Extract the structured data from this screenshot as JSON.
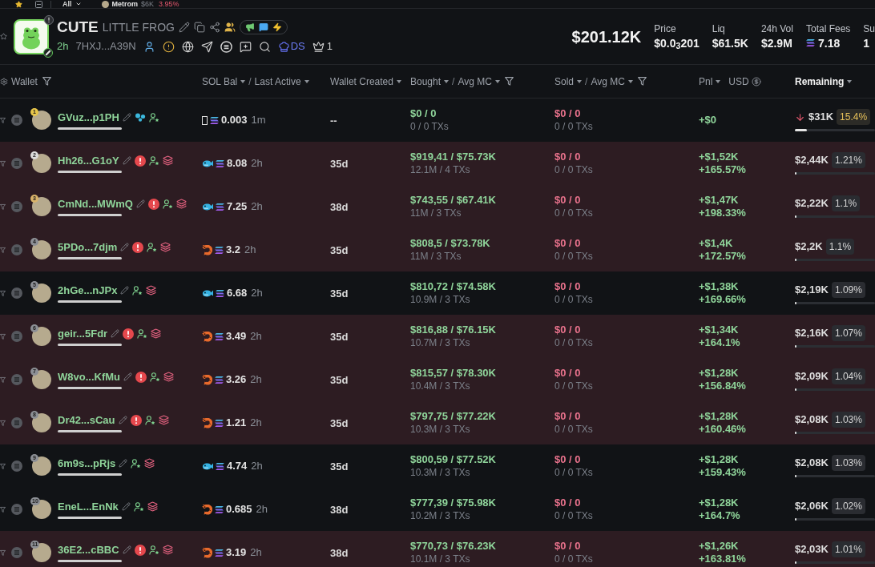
{
  "top_bar": {
    "filter": "All",
    "ticker": {
      "name": "Metrom",
      "price": "$6K",
      "change": "3.95%"
    }
  },
  "token": {
    "symbol": "CUTE",
    "name": "LITTLE FROG",
    "age": "2h",
    "address": "7HXJ...A39N",
    "ds_label": "DS",
    "crown_count": "1",
    "market_cap": "$201.12K",
    "stats": [
      {
        "label": "Price",
        "value": "$0.0$_{3}$201",
        "kind": "plain"
      },
      {
        "label": "Liq",
        "value": "$61.5K",
        "kind": "plain"
      },
      {
        "label": "24h Vol",
        "value": "$2.9M",
        "kind": "plain"
      },
      {
        "label": "Total Fees",
        "value": "7.18",
        "kind": "sol"
      },
      {
        "label": "Su",
        "value": "1",
        "kind": "plain"
      }
    ]
  },
  "table": {
    "columns": [
      {
        "kind": "wallet",
        "parts": [
          {
            "kind": "label",
            "label": "Wallet",
            "sort": false
          }
        ],
        "filter": true,
        "active": false
      },
      {
        "kind": "sol",
        "parts": [
          {
            "kind": "label",
            "label": "SOL Bal",
            "sort": true
          },
          {
            "kind": "separator",
            "label": "/",
            "sort": false
          },
          {
            "kind": "label",
            "label": "Last Active",
            "sort": true
          }
        ],
        "filter": false,
        "active": false
      },
      {
        "kind": "created",
        "parts": [
          {
            "kind": "label",
            "label": "Wallet Created",
            "sort": true
          }
        ],
        "filter": false,
        "active": false
      },
      {
        "kind": "bought",
        "parts": [
          {
            "kind": "label",
            "label": "Bought",
            "sort": true
          },
          {
            "kind": "separator",
            "label": "/",
            "sort": false
          },
          {
            "kind": "label",
            "label": "Avg MC",
            "sort": true
          }
        ],
        "filter": true,
        "active": false
      },
      {
        "kind": "sold",
        "parts": [
          {
            "kind": "label",
            "label": "Sold",
            "sort": true
          },
          {
            "kind": "separator",
            "label": "/",
            "sort": false
          },
          {
            "kind": "label",
            "label": "Avg MC",
            "sort": true
          }
        ],
        "filter": true,
        "active": false
      },
      {
        "kind": "pnl",
        "parts": [
          {
            "kind": "label",
            "label": "Pnl",
            "sort": true
          }
        ],
        "unit": "USD",
        "filter": false,
        "active": false
      },
      {
        "kind": "remaining",
        "parts": [
          {
            "kind": "label",
            "label": "Remaining",
            "sort": true
          }
        ],
        "filter": false,
        "active": true
      }
    ],
    "rows": [
      {
        "rank": {
          "text": "1",
          "color": "#e8c64a"
        },
        "wallet": "GVuz...p1PH",
        "highlighted": false,
        "tags": [
          {
            "kind": "bubbles"
          },
          {
            "kind": "user_star"
          }
        ],
        "holder": {
          "kind": "box"
        },
        "sol": "0.003",
        "last_active": "1m",
        "created": "--",
        "bought": {
          "line": "$0 / 0",
          "detail": "0 / 0 TXs"
        },
        "sold": {
          "line": "$0 / 0",
          "detail": "0 / 0 TXs"
        },
        "pnl": {
          "usd": "+$0"
        },
        "remaining": {
          "usd": "$31K",
          "percent": "15.4%",
          "falling": true,
          "warning": true,
          "level": 0.154
        }
      },
      {
        "rank": {
          "text": "2",
          "color": "#dcdcdc"
        },
        "wallet": "Hh26...G1oY",
        "highlighted": true,
        "tags": [
          {
            "kind": "alert"
          },
          {
            "kind": "user_star"
          },
          {
            "kind": "layers"
          }
        ],
        "holder": {
          "kind": "fish"
        },
        "sol": "8.08",
        "last_active": "2h",
        "created": "35d",
        "bought": {
          "line": "$919,41 / $75.73K",
          "detail": "12.1M / 4 TXs"
        },
        "sold": {
          "line": "$0 / 0",
          "detail": "0 / 0 TXs"
        },
        "pnl": {
          "usd": "+$1,52K",
          "percent": "+165.57%"
        },
        "remaining": {
          "usd": "$2,44K",
          "percent": "1.21%",
          "falling": false,
          "warning": false,
          "level": 0.0121
        }
      },
      {
        "rank": {
          "text": "3",
          "color": "#d9b36a"
        },
        "wallet": "CmNd...MWmQ",
        "highlighted": true,
        "tags": [
          {
            "kind": "alert"
          },
          {
            "kind": "user_star"
          },
          {
            "kind": "layers"
          }
        ],
        "holder": {
          "kind": "fish"
        },
        "sol": "7.25",
        "last_active": "2h",
        "created": "38d",
        "bought": {
          "line": "$743,55 / $67.41K",
          "detail": "11M / 3 TXs"
        },
        "sold": {
          "line": "$0 / 0",
          "detail": "0 / 0 TXs"
        },
        "pnl": {
          "usd": "+$1,47K",
          "percent": "+198.33%"
        },
        "remaining": {
          "usd": "$2,22K",
          "percent": "1.1%",
          "falling": false,
          "warning": false,
          "level": 0.011
        }
      },
      {
        "rank": {
          "text": "4",
          "color": "#8c8f95"
        },
        "wallet": "5PDo...7djm",
        "highlighted": true,
        "tags": [
          {
            "kind": "alert"
          },
          {
            "kind": "user_star"
          },
          {
            "kind": "layers"
          }
        ],
        "holder": {
          "kind": "shrimp"
        },
        "sol": "3.2",
        "last_active": "2h",
        "created": "35d",
        "bought": {
          "line": "$808,5 / $73.78K",
          "detail": "11M / 3 TXs"
        },
        "sold": {
          "line": "$0 / 0",
          "detail": "0 / 0 TXs"
        },
        "pnl": {
          "usd": "+$1,4K",
          "percent": "+172.57%"
        },
        "remaining": {
          "usd": "$2,2K",
          "percent": "1.1%",
          "falling": false,
          "warning": false,
          "level": 0.011
        }
      },
      {
        "rank": {
          "text": "5",
          "color": "#8c8f95"
        },
        "wallet": "2hGe...nJPx",
        "highlighted": false,
        "tags": [
          {
            "kind": "user_star"
          },
          {
            "kind": "layers"
          }
        ],
        "holder": {
          "kind": "fish"
        },
        "sol": "6.68",
        "last_active": "2h",
        "created": "35d",
        "bought": {
          "line": "$810,72 / $74.58K",
          "detail": "10.9M / 3 TXs"
        },
        "sold": {
          "line": "$0 / 0",
          "detail": "0 / 0 TXs"
        },
        "pnl": {
          "usd": "+$1,38K",
          "percent": "+169.66%"
        },
        "remaining": {
          "usd": "$2,19K",
          "percent": "1.09%",
          "falling": false,
          "warning": false,
          "level": 0.0109
        }
      },
      {
        "rank": {
          "text": "6",
          "color": "#8c8f95"
        },
        "wallet": "geir...5Fdr",
        "highlighted": true,
        "tags": [
          {
            "kind": "alert"
          },
          {
            "kind": "user_star"
          },
          {
            "kind": "layers"
          }
        ],
        "holder": {
          "kind": "shrimp"
        },
        "sol": "3.49",
        "last_active": "2h",
        "created": "35d",
        "bought": {
          "line": "$816,88 / $76.15K",
          "detail": "10.7M / 3 TXs"
        },
        "sold": {
          "line": "$0 / 0",
          "detail": "0 / 0 TXs"
        },
        "pnl": {
          "usd": "+$1,34K",
          "percent": "+164.1%"
        },
        "remaining": {
          "usd": "$2,16K",
          "percent": "1.07%",
          "falling": false,
          "warning": false,
          "level": 0.0107
        }
      },
      {
        "rank": {
          "text": "7",
          "color": "#8c8f95"
        },
        "wallet": "W8vo...KfMu",
        "highlighted": true,
        "tags": [
          {
            "kind": "alert"
          },
          {
            "kind": "user_star"
          },
          {
            "kind": "layers"
          }
        ],
        "holder": {
          "kind": "shrimp"
        },
        "sol": "3.26",
        "last_active": "2h",
        "created": "35d",
        "bought": {
          "line": "$815,57 / $78.30K",
          "detail": "10.4M / 3 TXs"
        },
        "sold": {
          "line": "$0 / 0",
          "detail": "0 / 0 TXs"
        },
        "pnl": {
          "usd": "+$1,28K",
          "percent": "+156.84%"
        },
        "remaining": {
          "usd": "$2,09K",
          "percent": "1.04%",
          "falling": false,
          "warning": false,
          "level": 0.0104
        }
      },
      {
        "rank": {
          "text": "8",
          "color": "#8c8f95"
        },
        "wallet": "Dr42...sCau",
        "highlighted": true,
        "tags": [
          {
            "kind": "alert"
          },
          {
            "kind": "user_star"
          },
          {
            "kind": "layers"
          }
        ],
        "holder": {
          "kind": "shrimp"
        },
        "sol": "1.21",
        "last_active": "2h",
        "created": "35d",
        "bought": {
          "line": "$797,75 / $77.22K",
          "detail": "10.3M / 3 TXs"
        },
        "sold": {
          "line": "$0 / 0",
          "detail": "0 / 0 TXs"
        },
        "pnl": {
          "usd": "+$1,28K",
          "percent": "+160.46%"
        },
        "remaining": {
          "usd": "$2,08K",
          "percent": "1.03%",
          "falling": false,
          "warning": false,
          "level": 0.0103
        }
      },
      {
        "rank": {
          "text": "9",
          "color": "#8c8f95"
        },
        "wallet": "6m9s...pRjs",
        "highlighted": false,
        "tags": [
          {
            "kind": "user_star"
          },
          {
            "kind": "layers"
          }
        ],
        "holder": {
          "kind": "fish"
        },
        "sol": "4.74",
        "last_active": "2h",
        "created": "35d",
        "bought": {
          "line": "$800,59 / $77.52K",
          "detail": "10.3M / 3 TXs"
        },
        "sold": {
          "line": "$0 / 0",
          "detail": "0 / 0 TXs"
        },
        "pnl": {
          "usd": "+$1,28K",
          "percent": "+159.43%"
        },
        "remaining": {
          "usd": "$2,08K",
          "percent": "1.03%",
          "falling": false,
          "warning": false,
          "level": 0.0103
        }
      },
      {
        "rank": {
          "text": "10",
          "color": "#8c8f95"
        },
        "wallet": "EneL...EnNk",
        "highlighted": false,
        "tags": [
          {
            "kind": "user_star"
          },
          {
            "kind": "layers"
          }
        ],
        "holder": {
          "kind": "shrimp"
        },
        "sol": "0.685",
        "last_active": "2h",
        "created": "38d",
        "bought": {
          "line": "$777,39 / $75.98K",
          "detail": "10.2M / 3 TXs"
        },
        "sold": {
          "line": "$0 / 0",
          "detail": "0 / 0 TXs"
        },
        "pnl": {
          "usd": "+$1,28K",
          "percent": "+164.7%"
        },
        "remaining": {
          "usd": "$2,06K",
          "percent": "1.02%",
          "falling": false,
          "warning": false,
          "level": 0.0102
        }
      },
      {
        "rank": {
          "text": "11",
          "color": "#8c8f95"
        },
        "wallet": "36E2...cBBC",
        "highlighted": true,
        "tags": [
          {
            "kind": "alert"
          },
          {
            "kind": "user_star"
          },
          {
            "kind": "layers"
          }
        ],
        "holder": {
          "kind": "shrimp"
        },
        "sol": "3.19",
        "last_active": "2h",
        "created": "38d",
        "bought": {
          "line": "$770,73 / $76.23K",
          "detail": "10.1M / 3 TXs"
        },
        "sold": {
          "line": "$0 / 0",
          "detail": "0 / 0 TXs"
        },
        "pnl": {
          "usd": "+$1,26K",
          "percent": "+163.81%"
        },
        "remaining": {
          "usd": "$2,03K",
          "percent": "1.01%",
          "falling": false,
          "warning": false,
          "level": 0.0101
        }
      }
    ]
  }
}
